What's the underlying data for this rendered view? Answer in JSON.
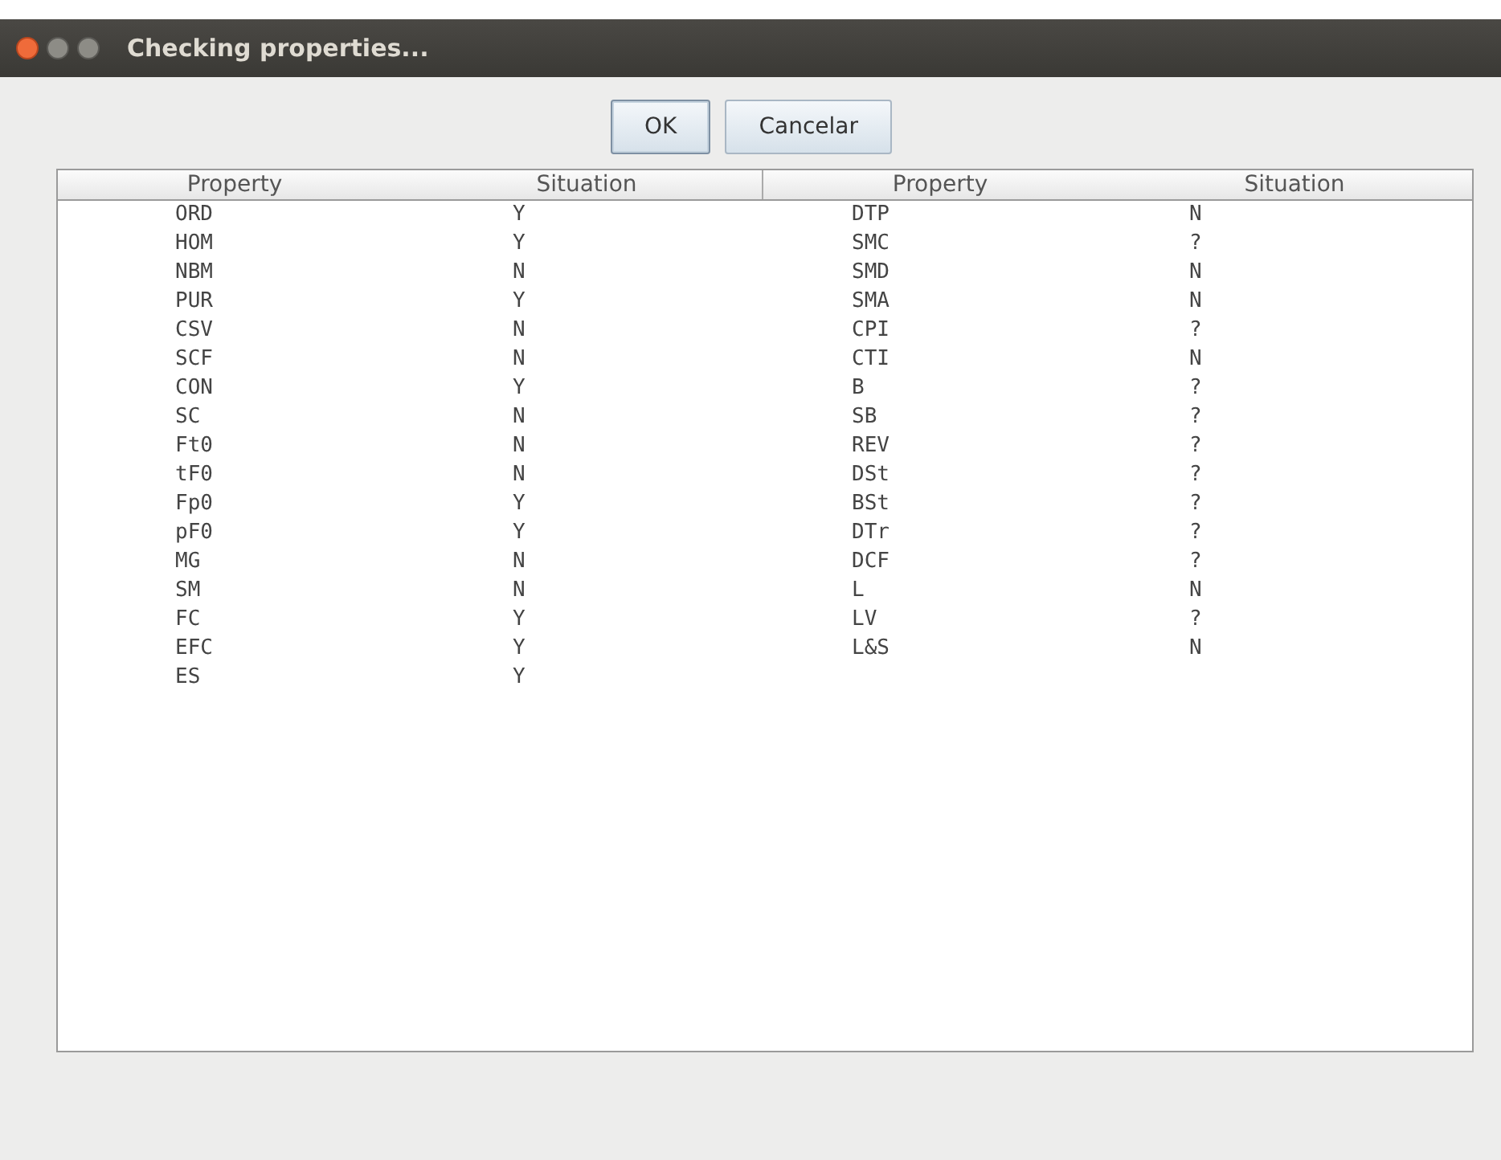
{
  "window": {
    "title": "Checking properties..."
  },
  "buttons": [
    {
      "label": "OK",
      "focused": true
    },
    {
      "label": "Cancelar",
      "focused": false
    }
  ],
  "table": {
    "columns": [
      "Property",
      "Situation",
      "Property",
      "Situation"
    ],
    "rows": [
      [
        "ORD",
        "Y",
        "DTP",
        "N"
      ],
      [
        "HOM",
        "Y",
        "SMC",
        "?"
      ],
      [
        "NBM",
        "N",
        "SMD",
        "N"
      ],
      [
        "PUR",
        "Y",
        "SMA",
        "N"
      ],
      [
        "CSV",
        "N",
        "CPI",
        "?"
      ],
      [
        "SCF",
        "N",
        "CTI",
        "N"
      ],
      [
        "CON",
        "Y",
        "B",
        "?"
      ],
      [
        "SC",
        "N",
        "SB",
        "?"
      ],
      [
        "Ft0",
        "N",
        "REV",
        "?"
      ],
      [
        "tF0",
        "N",
        "DSt",
        "?"
      ],
      [
        "Fp0",
        "Y",
        "BSt",
        "?"
      ],
      [
        "pF0",
        "Y",
        "DTr",
        "?"
      ],
      [
        "MG",
        "N",
        "DCF",
        "?"
      ],
      [
        "SM",
        "N",
        "L",
        "N"
      ],
      [
        "FC",
        "Y",
        "LV",
        "?"
      ],
      [
        "EFC",
        "Y",
        "L&S",
        "N"
      ],
      [
        "ES",
        "Y"
      ]
    ]
  }
}
